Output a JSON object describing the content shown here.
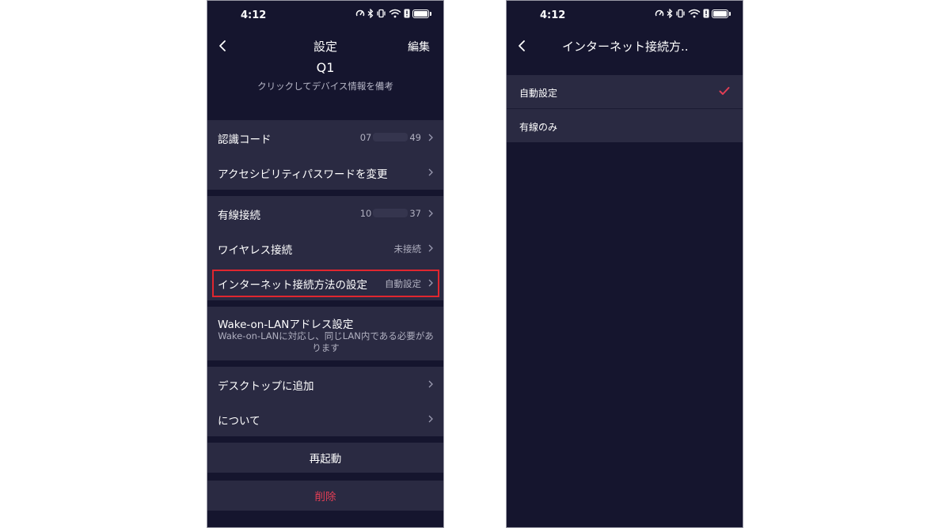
{
  "colors": {
    "background": "#15152e",
    "card": "#2a2a42",
    "accent": "#e13e55",
    "highlight": "#e0262f",
    "muted": "#b0b0c0"
  },
  "left": {
    "status": {
      "time": "4:12"
    },
    "header": {
      "title": "設定",
      "edit_label": "編集",
      "back_icon": "chevron-left-icon"
    },
    "device": {
      "name": "Q1",
      "note": "クリックしてデバイス情報を備考"
    },
    "group1": [
      {
        "label": "認識コード",
        "value_prefix": "07",
        "value_suffix": "49"
      },
      {
        "label": "アクセシビリティパスワードを変更"
      }
    ],
    "group2": [
      {
        "label": "有線接続",
        "value_prefix": "10",
        "value_suffix": "37"
      },
      {
        "label": "ワイヤレス接続",
        "value": "未接続"
      },
      {
        "label": "インターネット接続方法の設定",
        "value": "自動設定"
      }
    ],
    "wol": {
      "title": "Wake-on-LANアドレス設定",
      "desc": "Wake-on-LANに対応し、同じLAN内である必要があります"
    },
    "group3": [
      {
        "label": "デスクトップに追加"
      },
      {
        "label": "について"
      }
    ],
    "restart_label": "再起動",
    "delete_label": "削除"
  },
  "right": {
    "status": {
      "time": "4:12"
    },
    "header": {
      "title": "インターネット接続方.."
    },
    "options": [
      {
        "label": "自動設定",
        "selected": true
      },
      {
        "label": "有線のみ",
        "selected": false
      }
    ]
  }
}
